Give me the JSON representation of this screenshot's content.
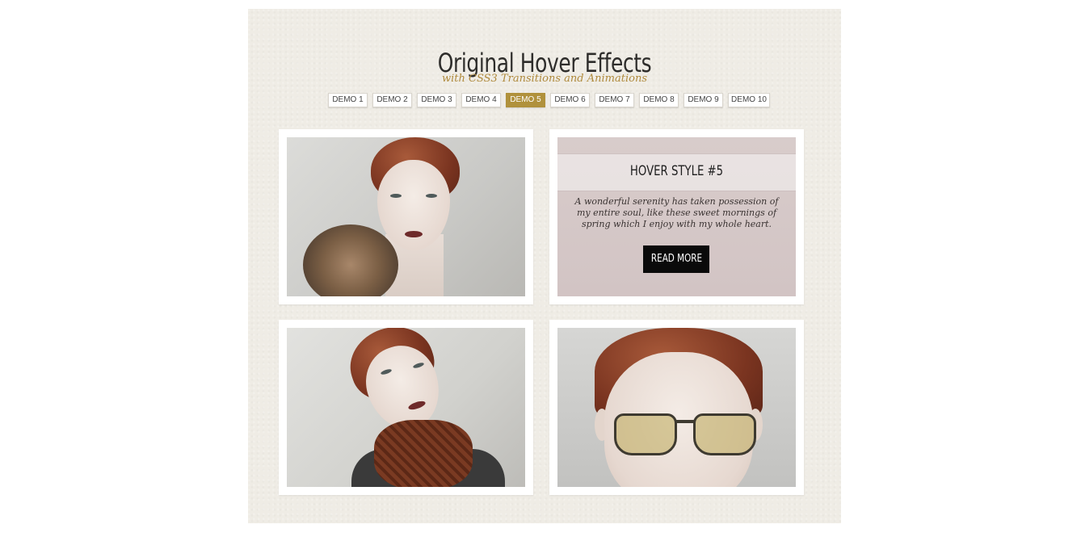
{
  "header": {
    "title": "Original Hover Effects",
    "subtitle": "with CSS3 Transitions and Animations"
  },
  "demos": [
    {
      "label": "DEMO 1",
      "active": false
    },
    {
      "label": "DEMO 2",
      "active": false
    },
    {
      "label": "DEMO 3",
      "active": false
    },
    {
      "label": "DEMO 4",
      "active": false
    },
    {
      "label": "DEMO 5",
      "active": true
    },
    {
      "label": "DEMO 6",
      "active": false
    },
    {
      "label": "DEMO 7",
      "active": false
    },
    {
      "label": "DEMO 8",
      "active": false
    },
    {
      "label": "DEMO 9",
      "active": false
    },
    {
      "label": "DEMO 10",
      "active": false
    }
  ],
  "hover_card": {
    "title": "HOVER STYLE #5",
    "text": "A wonderful serenity has taken possession of my entire soul, like these sweet mornings of spring which I enjoy with my whole heart.",
    "button_label": "READ MORE"
  },
  "colors": {
    "accent": "#b0913c",
    "page_bg": "#efece5",
    "button_bg": "#0a0a0a"
  }
}
